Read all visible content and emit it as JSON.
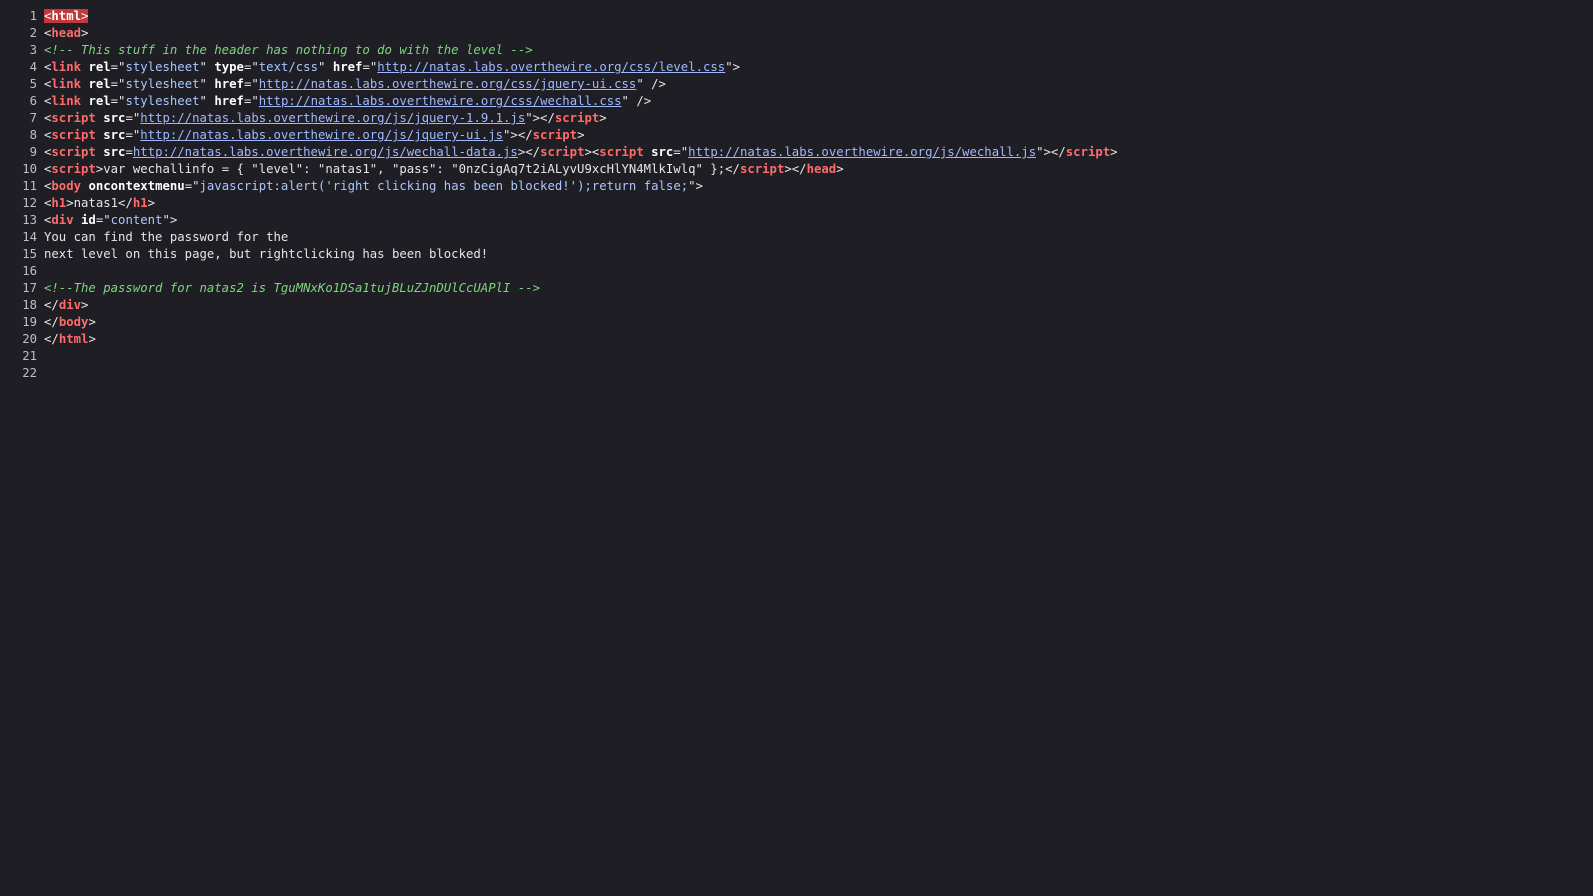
{
  "lines": [
    {
      "n": "1",
      "tokens": [
        {
          "t": "hl-open",
          "v": "<"
        },
        {
          "t": "hl-tag",
          "v": "html"
        },
        {
          "t": "hl-close",
          "v": ">"
        }
      ]
    },
    {
      "n": "2",
      "tokens": [
        {
          "t": "brk",
          "v": "<"
        },
        {
          "t": "tag",
          "v": "head"
        },
        {
          "t": "brk",
          "v": ">"
        }
      ]
    },
    {
      "n": "3",
      "tokens": [
        {
          "t": "cmt",
          "v": "<!-- This stuff in the header has nothing to do with the level -->"
        }
      ]
    },
    {
      "n": "4",
      "tokens": [
        {
          "t": "brk",
          "v": "<"
        },
        {
          "t": "tag",
          "v": "link"
        },
        {
          "t": "txt",
          "v": " "
        },
        {
          "t": "attr",
          "v": "rel"
        },
        {
          "t": "brk",
          "v": "=\""
        },
        {
          "t": "val",
          "v": "stylesheet"
        },
        {
          "t": "brk",
          "v": "\" "
        },
        {
          "t": "attr",
          "v": "type"
        },
        {
          "t": "brk",
          "v": "=\""
        },
        {
          "t": "val",
          "v": "text/css"
        },
        {
          "t": "brk",
          "v": "\" "
        },
        {
          "t": "attr",
          "v": "href"
        },
        {
          "t": "brk",
          "v": "=\""
        },
        {
          "t": "link",
          "v": "http://natas.labs.overthewire.org/css/level.css"
        },
        {
          "t": "brk",
          "v": "\">"
        }
      ]
    },
    {
      "n": "5",
      "tokens": [
        {
          "t": "brk",
          "v": "<"
        },
        {
          "t": "tag",
          "v": "link"
        },
        {
          "t": "txt",
          "v": " "
        },
        {
          "t": "attr",
          "v": "rel"
        },
        {
          "t": "brk",
          "v": "=\""
        },
        {
          "t": "val",
          "v": "stylesheet"
        },
        {
          "t": "brk",
          "v": "\" "
        },
        {
          "t": "attr",
          "v": "href"
        },
        {
          "t": "brk",
          "v": "=\""
        },
        {
          "t": "link",
          "v": "http://natas.labs.overthewire.org/css/jquery-ui.css"
        },
        {
          "t": "brk",
          "v": "\" />"
        }
      ]
    },
    {
      "n": "6",
      "tokens": [
        {
          "t": "brk",
          "v": "<"
        },
        {
          "t": "tag",
          "v": "link"
        },
        {
          "t": "txt",
          "v": " "
        },
        {
          "t": "attr",
          "v": "rel"
        },
        {
          "t": "brk",
          "v": "=\""
        },
        {
          "t": "val",
          "v": "stylesheet"
        },
        {
          "t": "brk",
          "v": "\" "
        },
        {
          "t": "attr",
          "v": "href"
        },
        {
          "t": "brk",
          "v": "=\""
        },
        {
          "t": "link",
          "v": "http://natas.labs.overthewire.org/css/wechall.css"
        },
        {
          "t": "brk",
          "v": "\" />"
        }
      ]
    },
    {
      "n": "7",
      "tokens": [
        {
          "t": "brk",
          "v": "<"
        },
        {
          "t": "tag",
          "v": "script"
        },
        {
          "t": "txt",
          "v": " "
        },
        {
          "t": "attr",
          "v": "src"
        },
        {
          "t": "brk",
          "v": "=\""
        },
        {
          "t": "link",
          "v": "http://natas.labs.overthewire.org/js/jquery-1.9.1.js"
        },
        {
          "t": "brk",
          "v": "\"></"
        },
        {
          "t": "tag",
          "v": "script"
        },
        {
          "t": "brk",
          "v": ">"
        }
      ]
    },
    {
      "n": "8",
      "tokens": [
        {
          "t": "brk",
          "v": "<"
        },
        {
          "t": "tag",
          "v": "script"
        },
        {
          "t": "txt",
          "v": " "
        },
        {
          "t": "attr",
          "v": "src"
        },
        {
          "t": "brk",
          "v": "=\""
        },
        {
          "t": "link",
          "v": "http://natas.labs.overthewire.org/js/jquery-ui.js"
        },
        {
          "t": "brk",
          "v": "\"></"
        },
        {
          "t": "tag",
          "v": "script"
        },
        {
          "t": "brk",
          "v": ">"
        }
      ]
    },
    {
      "n": "9",
      "tokens": [
        {
          "t": "brk",
          "v": "<"
        },
        {
          "t": "tag",
          "v": "script"
        },
        {
          "t": "txt",
          "v": " "
        },
        {
          "t": "attr",
          "v": "src"
        },
        {
          "t": "brk",
          "v": "="
        },
        {
          "t": "link",
          "v": "http://natas.labs.overthewire.org/js/wechall-data.js"
        },
        {
          "t": "brk",
          "v": "></"
        },
        {
          "t": "tag",
          "v": "script"
        },
        {
          "t": "brk",
          "v": "><"
        },
        {
          "t": "tag",
          "v": "script"
        },
        {
          "t": "txt",
          "v": " "
        },
        {
          "t": "attr",
          "v": "src"
        },
        {
          "t": "brk",
          "v": "=\""
        },
        {
          "t": "link",
          "v": "http://natas.labs.overthewire.org/js/wechall.js"
        },
        {
          "t": "brk",
          "v": "\"></"
        },
        {
          "t": "tag",
          "v": "script"
        },
        {
          "t": "brk",
          "v": ">"
        }
      ]
    },
    {
      "n": "10",
      "tokens": [
        {
          "t": "brk",
          "v": "<"
        },
        {
          "t": "tag",
          "v": "script"
        },
        {
          "t": "brk",
          "v": ">"
        },
        {
          "t": "txt",
          "v": "var wechallinfo = { \"level\": \"natas1\", \"pass\": \"0nzCigAq7t2iALyvU9xcHlYN4MlkIwlq\" };"
        },
        {
          "t": "brk",
          "v": "</"
        },
        {
          "t": "tag",
          "v": "script"
        },
        {
          "t": "brk",
          "v": "></"
        },
        {
          "t": "tag",
          "v": "head"
        },
        {
          "t": "brk",
          "v": ">"
        }
      ]
    },
    {
      "n": "11",
      "tokens": [
        {
          "t": "brk",
          "v": "<"
        },
        {
          "t": "tag",
          "v": "body"
        },
        {
          "t": "txt",
          "v": " "
        },
        {
          "t": "attr",
          "v": "oncontextmenu"
        },
        {
          "t": "brk",
          "v": "=\""
        },
        {
          "t": "val",
          "v": "javascript:alert('right clicking has been blocked!');return false;"
        },
        {
          "t": "brk",
          "v": "\">"
        }
      ]
    },
    {
      "n": "12",
      "tokens": [
        {
          "t": "brk",
          "v": "<"
        },
        {
          "t": "tag",
          "v": "h1"
        },
        {
          "t": "brk",
          "v": ">"
        },
        {
          "t": "txt",
          "v": "natas1"
        },
        {
          "t": "brk",
          "v": "</"
        },
        {
          "t": "tag",
          "v": "h1"
        },
        {
          "t": "brk",
          "v": ">"
        }
      ]
    },
    {
      "n": "13",
      "tokens": [
        {
          "t": "brk",
          "v": "<"
        },
        {
          "t": "tag",
          "v": "div"
        },
        {
          "t": "txt",
          "v": " "
        },
        {
          "t": "attr",
          "v": "id"
        },
        {
          "t": "brk",
          "v": "=\""
        },
        {
          "t": "val",
          "v": "content"
        },
        {
          "t": "brk",
          "v": "\">"
        }
      ]
    },
    {
      "n": "14",
      "tokens": [
        {
          "t": "txt",
          "v": "You can find the password for the"
        }
      ]
    },
    {
      "n": "15",
      "tokens": [
        {
          "t": "txt",
          "v": "next level on this page, but rightclicking has been blocked!"
        }
      ]
    },
    {
      "n": "16",
      "tokens": []
    },
    {
      "n": "17",
      "tokens": [
        {
          "t": "cmt",
          "v": "<!--The password for natas2 is TguMNxKo1DSa1tujBLuZJnDUlCcUAPlI -->"
        }
      ]
    },
    {
      "n": "18",
      "tokens": [
        {
          "t": "brk",
          "v": "</"
        },
        {
          "t": "tag",
          "v": "div"
        },
        {
          "t": "brk",
          "v": ">"
        }
      ]
    },
    {
      "n": "19",
      "tokens": [
        {
          "t": "brk",
          "v": "</"
        },
        {
          "t": "tag",
          "v": "body"
        },
        {
          "t": "brk",
          "v": ">"
        }
      ]
    },
    {
      "n": "20",
      "tokens": [
        {
          "t": "brk",
          "v": "</"
        },
        {
          "t": "tag",
          "v": "html"
        },
        {
          "t": "brk",
          "v": ">"
        }
      ]
    },
    {
      "n": "21",
      "tokens": []
    },
    {
      "n": "22",
      "tokens": []
    }
  ],
  "colors": {
    "background": "#1e1e24",
    "tag": "#ff6b6b",
    "comment": "#7ed67e",
    "link": "#9fb9ff",
    "selection": "#c4373b"
  }
}
